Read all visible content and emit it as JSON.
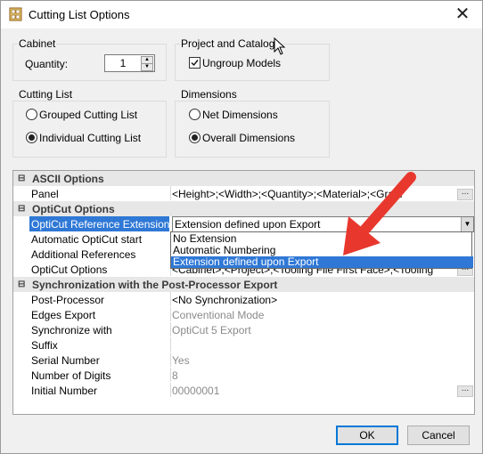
{
  "window": {
    "title": "Cutting List Options",
    "close_glyph": "✕"
  },
  "cabinet": {
    "label": "Cabinet",
    "quantity_label": "Quantity:",
    "quantity_value": "1"
  },
  "project_catalog": {
    "label": "Project and Catalog",
    "ungroup_label": "Ungroup Models",
    "ungroup_checked": true
  },
  "cutting_list": {
    "label": "Cutting List",
    "options": [
      "Grouped Cutting List",
      "Individual Cutting List"
    ],
    "selected": 1
  },
  "dimensions": {
    "label": "Dimensions",
    "options": [
      "Net Dimensions",
      "Overall Dimensions"
    ],
    "selected": 1
  },
  "grid": {
    "ascii_options": {
      "title": "ASCII Options",
      "panel_name": "Panel",
      "panel_value": "<Height>;<Width>;<Quantity>;<Material>;<Grain Direction..."
    },
    "opticut_options": {
      "title": "OptiCut Options",
      "rows": [
        {
          "name": "OptiCut Reference Extension",
          "value": "Extension defined upon Export"
        },
        {
          "name": "Automatic OptiCut start",
          "value": ""
        },
        {
          "name": "Additional References",
          "value": ""
        },
        {
          "name": "OptiCut Options",
          "value": "<Cabinet>;<Project>;<Tooling File First Face>;<Tooling File ..."
        }
      ]
    },
    "sync": {
      "title": "Synchronization with the Post-Processor Export",
      "rows": [
        {
          "name": "Post-Processor",
          "value": "<No Synchronization>"
        },
        {
          "name": "Edges Export",
          "value": "Conventional Mode"
        },
        {
          "name": "Synchronize with",
          "value": "OptiCut 5 Export"
        },
        {
          "name": "Suffix",
          "value": ""
        },
        {
          "name": "Serial Number",
          "value": "Yes"
        },
        {
          "name": "Number of Digits",
          "value": "8"
        },
        {
          "name": "Initial Number",
          "value": "00000001"
        }
      ]
    },
    "ellipsis": "..."
  },
  "dropdown": {
    "options": [
      "No Extension",
      "Automatic Numbering",
      "Extension defined upon Export"
    ],
    "selected": 2
  },
  "buttons": {
    "ok": "OK",
    "cancel": "Cancel"
  },
  "colors": {
    "selection": "#2f78d6",
    "annotation_arrow": "#e8382e"
  },
  "icons": {
    "title": "cutting-list-app-icon",
    "annotation": "red-arrow-icon",
    "cursor": "mouse-pointer-icon"
  }
}
